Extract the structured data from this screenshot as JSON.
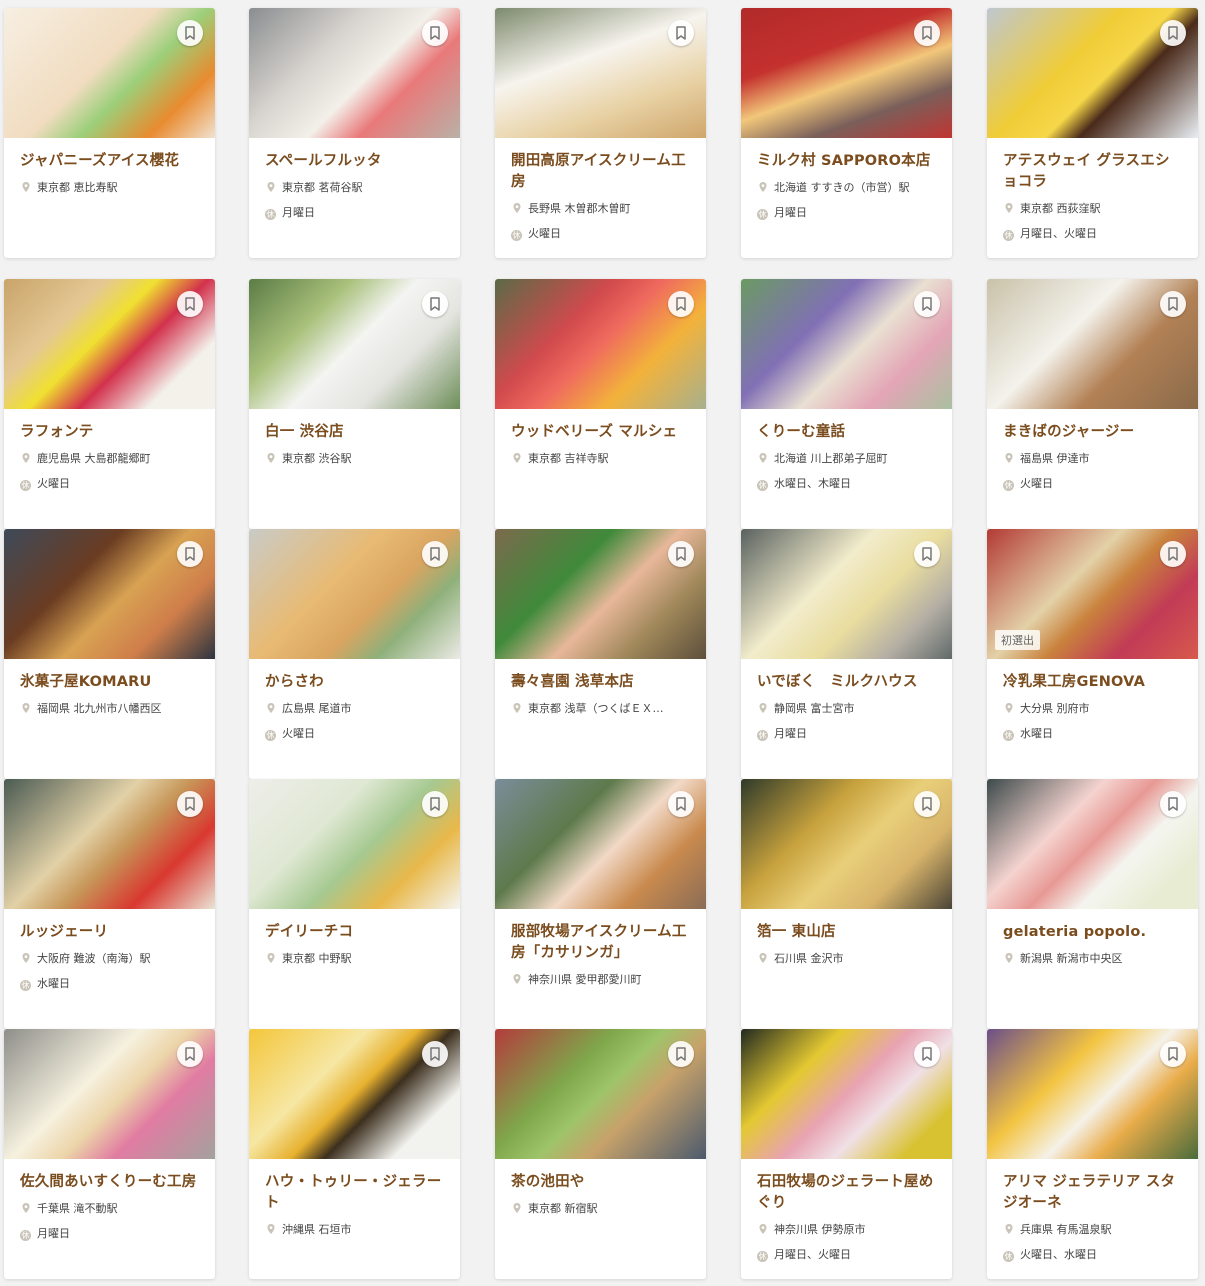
{
  "colors": {
    "title": "#7a4c1e",
    "text": "#444444",
    "icon": "#c9c3b8",
    "background": "#f2f2f2"
  },
  "shops": [
    {
      "name": "ジャパニーズアイス櫻花",
      "location": "東京都 恵比寿駅",
      "closed": "",
      "photo": "green tea gelato with cup of tea",
      "tag": ""
    },
    {
      "name": "スペールフルッタ",
      "location": "東京都 茗荷谷駅",
      "closed": "月曜日",
      "photo": "white and red gelato cup",
      "tag": ""
    },
    {
      "name": "開田高原アイスクリーム工房",
      "location": "長野県 木曽郡木曽町",
      "closed": "火曜日",
      "photo": "soft serve cone",
      "tag": ""
    },
    {
      "name": "ミルク村 SAPPORO本店",
      "location": "北海道 すすきの（市営）駅",
      "closed": "月曜日",
      "photo": "soft serve in glass",
      "tag": ""
    },
    {
      "name": "アテスウェイ グラスエショコラ",
      "location": "東京都 西荻窪駅",
      "closed": "月曜日、火曜日",
      "photo": "yellow gelato with chocolate",
      "tag": ""
    },
    {
      "name": "ラフォンテ",
      "location": "鹿児島県 大島郡龍郷町",
      "closed": "火曜日",
      "photo": "colorful gelato in basket",
      "tag": ""
    },
    {
      "name": "白一 渋谷店",
      "location": "東京都 渋谷駅",
      "closed": "",
      "photo": "tall white soft serve",
      "tag": ""
    },
    {
      "name": "ウッドベリーズ マルシェ",
      "location": "東京都 吉祥寺駅",
      "closed": "",
      "photo": "red and orange soft serve",
      "tag": ""
    },
    {
      "name": "くりーむ童話",
      "location": "北海道 川上郡弟子屈町",
      "closed": "水曜日、木曜日",
      "photo": "purple and pink gelato",
      "tag": ""
    },
    {
      "name": "まきばのジャージー",
      "location": "福島県 伊達市",
      "closed": "火曜日",
      "photo": "white soft serve cone",
      "tag": ""
    },
    {
      "name": "氷菓子屋KOMARU",
      "location": "福岡県 北九州市八幡西区",
      "closed": "",
      "photo": "chocolate soft serve",
      "tag": ""
    },
    {
      "name": "からさわ",
      "location": "広島県 尾道市",
      "closed": "火曜日",
      "photo": "ice monaka wafer",
      "tag": ""
    },
    {
      "name": "壽々喜園 浅草本店",
      "location": "東京都 浅草（つくばＥＸ…",
      "closed": "",
      "photo": "matcha gelato cone",
      "tag": ""
    },
    {
      "name": "いでぼく　ミルクハウス",
      "location": "静岡県 富士宮市",
      "closed": "月曜日",
      "photo": "large milk soft serve",
      "tag": ""
    },
    {
      "name": "冷乳果工房GENOVA",
      "location": "大分県 別府市",
      "closed": "水曜日",
      "photo": "gelato cup with nuts",
      "tag": "初選出"
    },
    {
      "name": "ルッジェーリ",
      "location": "大阪府 難波（南海）駅",
      "closed": "水曜日",
      "photo": "gelato with wafer",
      "tag": ""
    },
    {
      "name": "デイリーチコ",
      "location": "東京都 中野駅",
      "closed": "",
      "photo": "tall striped soft serve",
      "tag": ""
    },
    {
      "name": "服部牧場アイスクリーム工房「カサリンガ」",
      "location": "神奈川県 愛甲郡愛川町",
      "closed": "",
      "photo": "gelato cone outdoors",
      "tag": ""
    },
    {
      "name": "箔一 東山店",
      "location": "石川県 金沢市",
      "closed": "",
      "photo": "gold leaf soft serve",
      "tag": ""
    },
    {
      "name": "gelateria popolo.",
      "location": "新潟県 新潟市中央区",
      "closed": "",
      "photo": "pink and white gelato cup",
      "tag": ""
    },
    {
      "name": "佐久間あいすくりーむ工房",
      "location": "千葉県 滝不動駅",
      "closed": "月曜日",
      "photo": "white gelato in cup",
      "tag": ""
    },
    {
      "name": "ハウ・トゥリー・ジェラート",
      "location": "沖縄県 石垣市",
      "closed": "",
      "photo": "passion fruit shaved ice",
      "tag": ""
    },
    {
      "name": "茶の池田や",
      "location": "東京都 新宿駅",
      "closed": "",
      "photo": "matcha soft serve",
      "tag": ""
    },
    {
      "name": "石田牧場のジェラート屋めぐり",
      "location": "神奈川県 伊勢原市",
      "closed": "月曜日、火曜日",
      "photo": "pink gelato with flowers",
      "tag": ""
    },
    {
      "name": "アリマ ジェラテリア スタジオーネ",
      "location": "兵庫県 有馬温泉駅",
      "closed": "火曜日、水曜日",
      "photo": "gelato cup with mango",
      "tag": ""
    }
  ]
}
